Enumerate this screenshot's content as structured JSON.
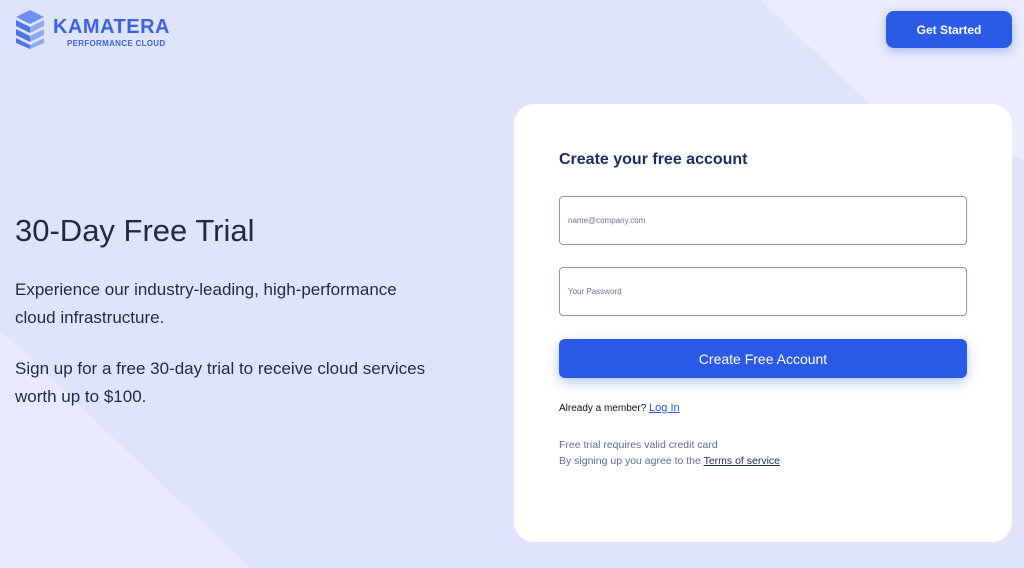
{
  "colors": {
    "accent": "#2b5be6",
    "background": "#dfe4fb",
    "card": "#ffffff",
    "title_dark": "#1a2e66"
  },
  "header": {
    "brand_name": "KAMATERA",
    "brand_tagline": "PERFORMANCE CLOUD",
    "cta_label": "Get Started"
  },
  "hero": {
    "title": "30-Day Free Trial",
    "paragraph_1": "Experience our industry-leading, high-performance cloud infrastructure.",
    "paragraph_2": "Sign up for a free 30-day trial to receive cloud services worth up to $100."
  },
  "signup": {
    "title": "Create your free account",
    "email_placeholder": "name@company.com",
    "password_placeholder": "Your Password",
    "submit_label": "Create Free Account",
    "member_prompt": "Already a member?",
    "login_link": "Log In",
    "credit_card_note": "Free trial requires valid credit card",
    "terms_prefix": "By signing up you agree to the",
    "terms_link": "Terms of service"
  },
  "icons": {
    "logo": "kamatera-stack-icon"
  }
}
